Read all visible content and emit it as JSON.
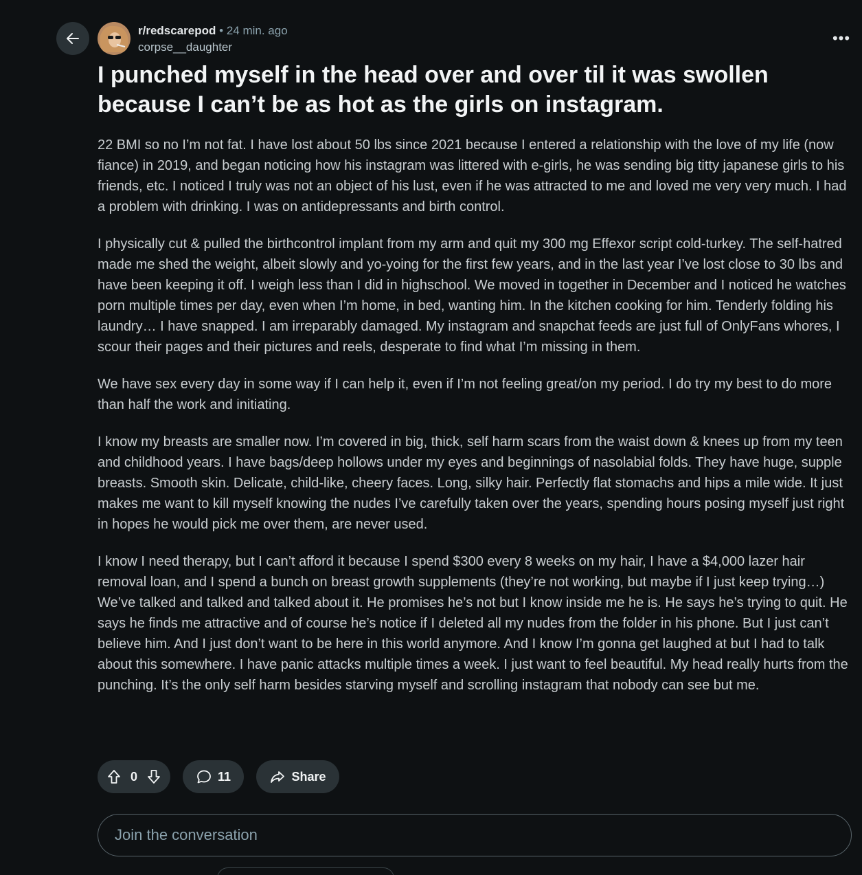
{
  "header": {
    "subreddit": "r/redscarepod",
    "separator": "•",
    "time": "24 min. ago",
    "username": "corpse__daughter",
    "more_label": "•••"
  },
  "post": {
    "title": "I punched myself in the head over and over til it was swollen because I can’t be as hot as the girls on instagram.",
    "paragraphs": [
      "22 BMI so no I’m not fat. I have lost about 50 lbs since 2021 because I entered a relationship with the love of my life (now fiance) in 2019, and began noticing how his instagram was littered with e-girls, he was sending big titty japanese girls to his friends, etc. I noticed I truly was not an object of his lust, even if he was attracted to me and loved me very very much. I had a problem with drinking. I was on antidepressants and birth control.",
      "I physically cut & pulled the birthcontrol implant from my arm and quit my 300 mg Effexor script cold-turkey. The self-hatred made me shed the weight, albeit slowly and yo-yoing for the first few years, and in the last year I’ve lost close to 30 lbs and have been keeping it off. I weigh less than I did in highschool. We moved in together in December and I noticed he watches porn multiple times per day, even when I’m home, in bed, wanting him. In the kitchen cooking for him. Tenderly folding his laundry… I have snapped. I am irreparably damaged. My instagram and snapchat feeds are just full of OnlyFans whores, I scour their pages and their pictures and reels, desperate to find what I’m missing in them.",
      "We have sex every day in some way if I can help it, even if I’m not feeling great/on my period. I do try my best to do more than half the work and initiating.",
      "I know my breasts are smaller now. I’m covered in big, thick, self harm scars from the waist down & knees up from my teen and childhood years. I have bags/deep hollows under my eyes and beginnings of nasolabial folds. They have huge, supple breasts. Smooth skin. Delicate, child-like, cheery faces. Long, silky hair. Perfectly flat stomachs and hips a mile wide. It just makes me want to kill myself knowing the nudes I’ve carefully taken over the years, spending hours posing myself just right in hopes he would pick me over them, are never used.",
      "I know I need therapy, but I can’t afford it because I spend $300 every 8 weeks on my hair, I have a $4,000 lazer hair removal loan, and I spend a bunch on breast growth supplements (they’re not working, but maybe if I just keep trying…) We’ve talked and talked and talked about it. He promises he’s not but I know inside me he is. He says he’s trying to quit. He says he finds me attractive and of course he’s notice if I deleted all my nudes from the folder in his phone. But I just can’t believe him. And I just don’t want to be here in this world anymore. And I know I’m gonna get laughed at but I had to talk about this somewhere. I have panic attacks multiple times a week. I just want to feel beautiful. My head really hurts from the punching. It’s the only self harm besides starving myself and scrolling instagram that nobody can see but me."
    ]
  },
  "actions": {
    "vote_count": "0",
    "comment_count": "11",
    "share_label": "Share"
  },
  "comment_box": {
    "placeholder": "Join the conversation"
  },
  "icons": {
    "back": "arrow-left-icon",
    "upvote": "arrow-up-icon",
    "downvote": "arrow-down-icon",
    "comment": "speech-bubble-icon",
    "share": "share-arrow-icon",
    "more": "ellipsis-icon"
  },
  "colors": {
    "background": "#0e1113",
    "pill": "#2a3236",
    "text": "#d7dadc",
    "muted": "#8ba2ad"
  }
}
